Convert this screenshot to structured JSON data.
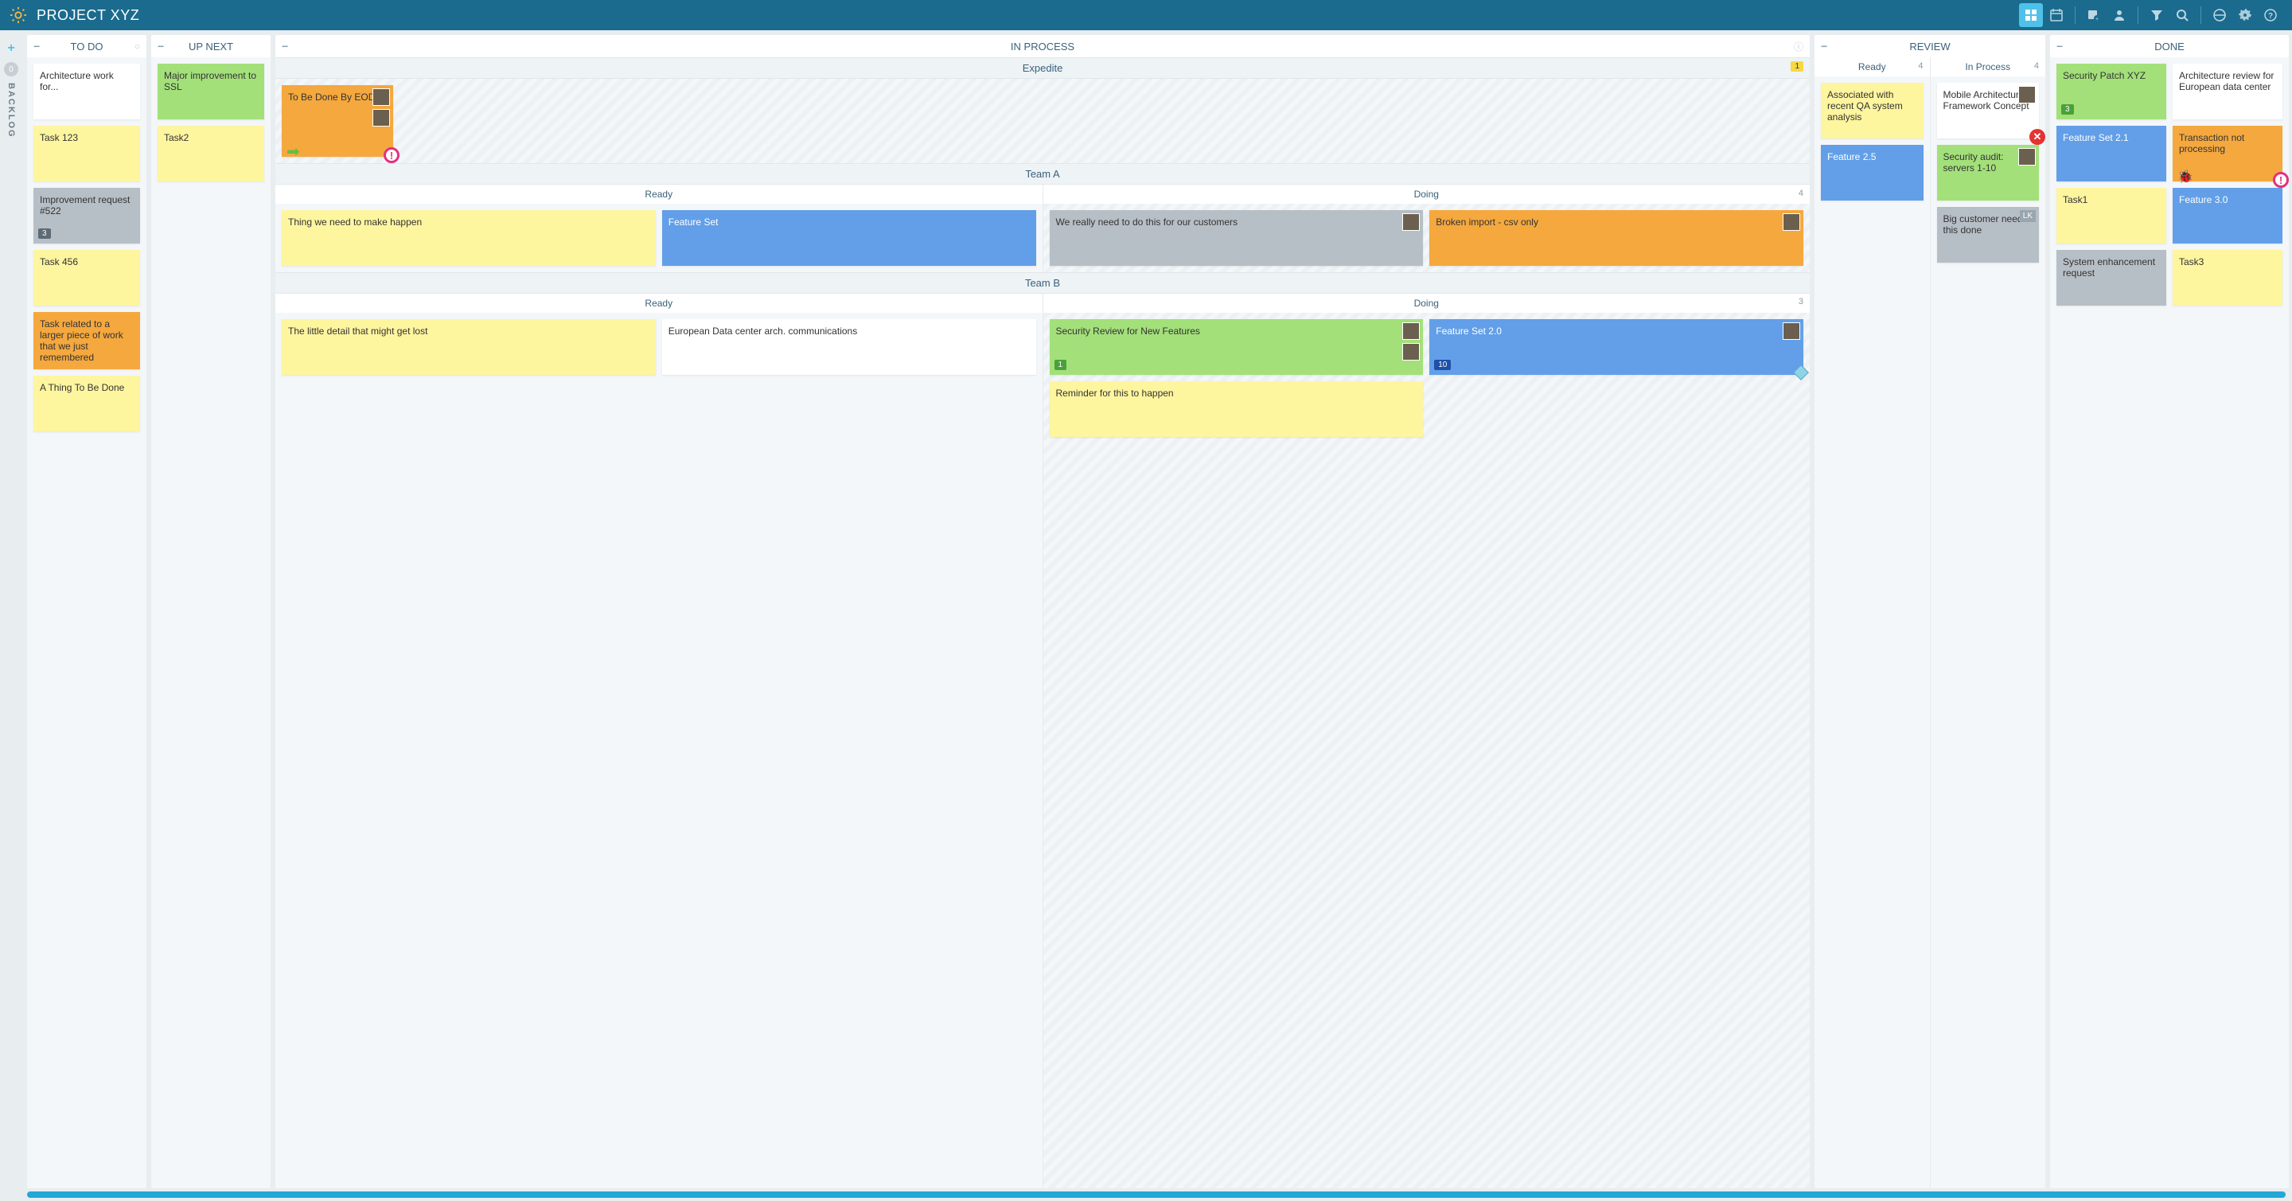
{
  "header": {
    "title": "PROJECT XYZ"
  },
  "backlog": {
    "label": "BACKLOG",
    "count": "0"
  },
  "columns": {
    "todo": {
      "title": "TO DO",
      "cards": [
        {
          "text": "Architecture work for...",
          "color": "white"
        },
        {
          "text": "Task 123",
          "color": "yellow"
        },
        {
          "text": "Improvement request #522",
          "color": "gray",
          "badge": "3"
        },
        {
          "text": "Task 456",
          "color": "yellow"
        },
        {
          "text": "Task related to a larger piece of work that we just remembered",
          "color": "orange"
        },
        {
          "text": "A Thing To Be Done",
          "color": "yellow"
        }
      ]
    },
    "upnext": {
      "title": "UP NEXT",
      "cards": [
        {
          "text": "Major improvement to SSL",
          "color": "green"
        },
        {
          "text": "Task2",
          "color": "yellow"
        }
      ]
    },
    "inprocess": {
      "title": "IN PROCESS",
      "expedite": {
        "title": "Expedite",
        "badge": "1",
        "card": {
          "text": "To Be Done By EOD!",
          "color": "orange"
        }
      },
      "teamA": {
        "title": "Team A",
        "ready": {
          "title": "Ready",
          "cards": [
            {
              "text": "Thing we need to make happen",
              "color": "yellow"
            },
            {
              "text": "Feature Set",
              "color": "blue"
            }
          ]
        },
        "doing": {
          "title": "Doing",
          "count": "4",
          "cards": [
            {
              "text": "We really need to do this for our customers",
              "color": "gray",
              "avatar": true
            },
            {
              "text": "Broken import - csv only",
              "color": "orange",
              "avatar": true
            }
          ]
        }
      },
      "teamB": {
        "title": "Team B",
        "ready": {
          "title": "Ready",
          "cards": [
            {
              "text": "The little detail that might get lost",
              "color": "yellow"
            },
            {
              "text": "European Data center arch. communications",
              "color": "white"
            }
          ]
        },
        "doing": {
          "title": "Doing",
          "count": "3",
          "cards": [
            {
              "text": "Security Review for New Features",
              "color": "green",
              "badge": "1",
              "avatars": 2
            },
            {
              "text": "Feature Set 2.0",
              "color": "blue",
              "badge": "10",
              "avatar": true,
              "diamond": true
            },
            {
              "text": "Reminder for this to happen",
              "color": "yellow"
            }
          ]
        }
      }
    },
    "review": {
      "title": "REVIEW",
      "ready": {
        "title": "Ready",
        "count": "4",
        "cards": [
          {
            "text": "Associated with recent QA system analysis",
            "color": "yellow"
          },
          {
            "text": "Feature 2.5",
            "color": "blue"
          }
        ]
      },
      "inprocess": {
        "title": "In Process",
        "count": "4",
        "cards": [
          {
            "text": "Mobile Architecture Framework Concept",
            "color": "white",
            "avatar": true,
            "redx": true
          },
          {
            "text": "Security audit: servers 1-10",
            "color": "green",
            "avatar": true
          },
          {
            "text": "Big customer needs this done",
            "color": "gray",
            "lk": "LK"
          }
        ]
      }
    },
    "done": {
      "title": "DONE",
      "cards": [
        {
          "text": "Security Patch XYZ",
          "color": "green",
          "badge": "3"
        },
        {
          "text": "Architecture review for European data center",
          "color": "white"
        },
        {
          "text": "Feature Set 2.1",
          "color": "blue"
        },
        {
          "text": "Transaction not processing",
          "color": "orange",
          "bug": true,
          "alert": true
        },
        {
          "text": "Task1",
          "color": "yellow"
        },
        {
          "text": "Feature 3.0",
          "color": "blue"
        },
        {
          "text": "System enhancement request",
          "color": "gray"
        },
        {
          "text": "Task3",
          "color": "yellow"
        }
      ]
    }
  }
}
